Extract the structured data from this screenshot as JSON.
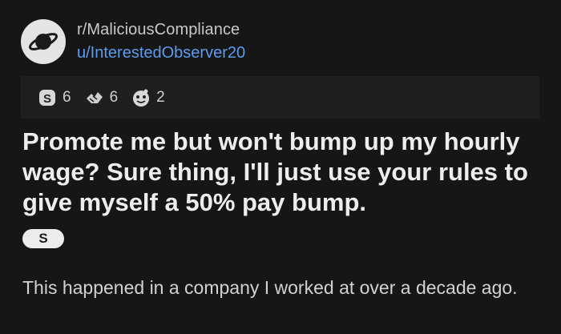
{
  "header": {
    "subreddit": "r/MaliciousCompliance",
    "username": "u/InterestedObserver20"
  },
  "awards": [
    {
      "icon": "silver-award-icon",
      "count": "6"
    },
    {
      "icon": "wholesome-award-icon",
      "count": "6"
    },
    {
      "icon": "helpful-award-icon",
      "count": "2"
    }
  ],
  "post": {
    "title": "Promote me but won't bump up my hourly wage? Sure thing, I'll just use your rules to give myself a 50% pay bump.",
    "flair": "S",
    "body": "This happened in a company I worked at over a decade ago."
  },
  "colors": {
    "background": "#161616",
    "username_link": "#5c9cf0",
    "award_bar": "#1f1f1f",
    "corner_accent": "#2e9e55"
  }
}
